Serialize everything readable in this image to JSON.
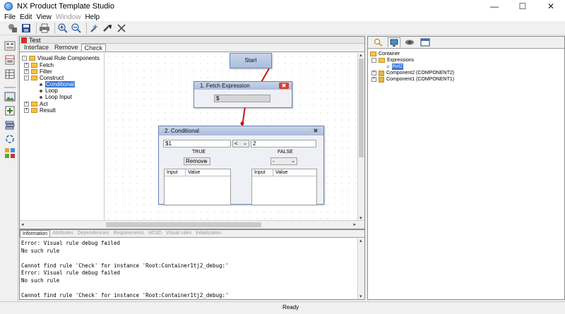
{
  "window": {
    "title": "NX Product Template Studio"
  },
  "menu": [
    {
      "label": "File",
      "disabled": false
    },
    {
      "label": "Edit",
      "disabled": false
    },
    {
      "label": "View",
      "disabled": false
    },
    {
      "label": "Window",
      "disabled": true
    },
    {
      "label": "Help",
      "disabled": false
    }
  ],
  "editor": {
    "title": "Test",
    "tabs": [
      "Interface",
      "Remove",
      "Check"
    ],
    "active_tab": "Check"
  },
  "component_tree": {
    "root": "Visual Rule Components",
    "items": [
      "Fetch",
      "Filter",
      "Construct",
      "Conditional",
      "Loop",
      "Loop Input",
      "Act",
      "Result"
    ],
    "selected": "Conditional"
  },
  "nodes": {
    "start": {
      "title": "Start"
    },
    "fetch": {
      "title": "1. Fetch Expression",
      "value": "$"
    },
    "conditional": {
      "title": "2. Conditional",
      "left_operand": "$1",
      "operator": "<",
      "right_operand": "2",
      "true_label": "TRUE",
      "false_label": "FALSE",
      "true_action": "Remove",
      "false_action": "-",
      "col_input": "Input",
      "col_value": "Value"
    }
  },
  "project_tree": {
    "container": "Container",
    "expressions": "Expressions",
    "expression_item": "Rel2",
    "component2": "Component2 (COMPONENT2)",
    "component1": "Component1 (COMPONENT1)"
  },
  "bottom_tabs": [
    "Information",
    "Attributes",
    "Dependencies",
    "Requirements",
    "HD3D",
    "Visual rules",
    "Initialization"
  ],
  "log_lines": [
    "Error: Visual rule debug failed",
    "No such rule",
    "",
    "Cannot find rule 'Check' for instance 'Root:Container1tj2_debug:'",
    "Error: Visual rule debug failed",
    "No such rule",
    "",
    "Cannot find rule 'Check' for instance 'Root:Container1tj2_debug:'"
  ],
  "status": "Ready",
  "colors": {
    "accent_selection": "#3875d7",
    "connector": "#cc1111",
    "close_active": "#d9402c",
    "close_inactive": "#b9c6dc"
  },
  "icons": [
    "new-component-icon",
    "save-icon",
    "print-icon",
    "zoom-in-icon",
    "zoom-out-icon",
    "add-node-icon",
    "link-icon",
    "delete-icon"
  ]
}
